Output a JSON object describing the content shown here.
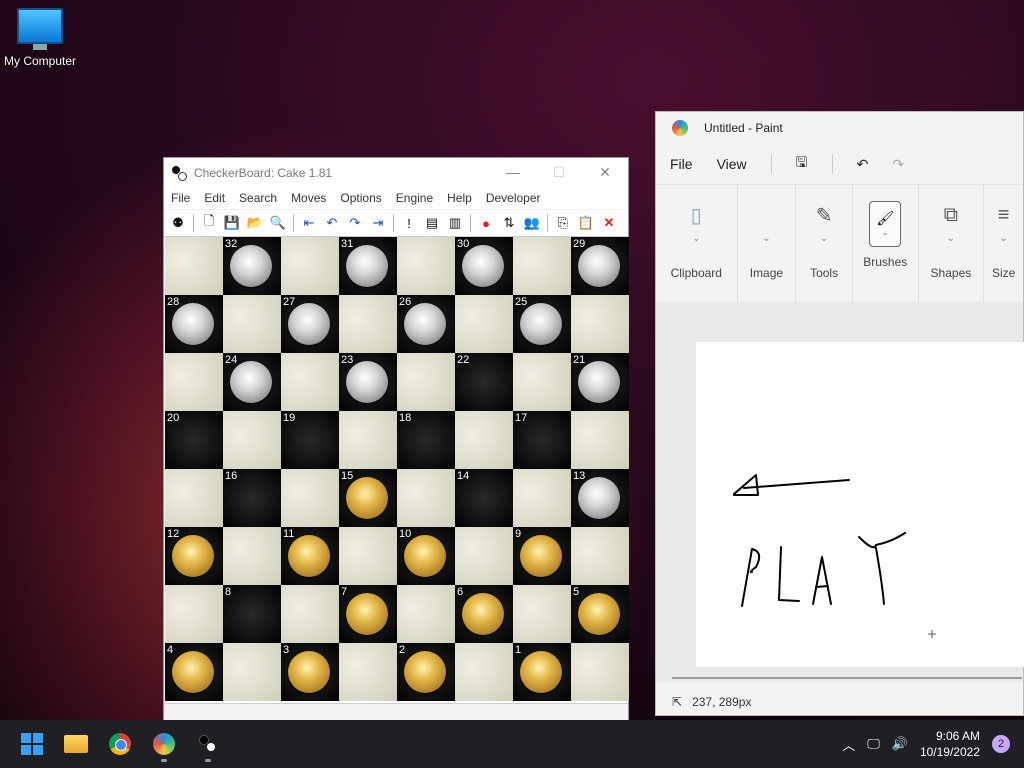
{
  "desktop": {
    "icon_label": "My Computer"
  },
  "checkers": {
    "title": "CheckerBoard: Cake 1.81",
    "menu": [
      "File",
      "Edit",
      "Search",
      "Moves",
      "Options",
      "Engine",
      "Help",
      "Developer"
    ],
    "board": [
      [
        null,
        {
          "n": "32",
          "p": "white"
        },
        null,
        {
          "n": "31",
          "p": "white"
        },
        null,
        {
          "n": "30",
          "p": "white"
        },
        null,
        {
          "n": "29",
          "p": "white"
        }
      ],
      [
        {
          "n": "28",
          "p": "white"
        },
        null,
        {
          "n": "27",
          "p": "white"
        },
        null,
        {
          "n": "26",
          "p": "white"
        },
        null,
        {
          "n": "25",
          "p": "white"
        },
        null
      ],
      [
        null,
        {
          "n": "24",
          "p": "white"
        },
        null,
        {
          "n": "23",
          "p": "white"
        },
        null,
        {
          "n": "22",
          "p": ""
        },
        null,
        {
          "n": "21",
          "p": "white"
        }
      ],
      [
        {
          "n": "20",
          "p": ""
        },
        null,
        {
          "n": "19",
          "p": ""
        },
        null,
        {
          "n": "18",
          "p": ""
        },
        null,
        {
          "n": "17",
          "p": ""
        },
        null
      ],
      [
        null,
        {
          "n": "16",
          "p": ""
        },
        null,
        {
          "n": "15",
          "p": "gold"
        },
        null,
        {
          "n": "14",
          "p": ""
        },
        null,
        {
          "n": "13",
          "p": "white"
        }
      ],
      [
        {
          "n": "12",
          "p": "gold"
        },
        null,
        {
          "n": "11",
          "p": "gold"
        },
        null,
        {
          "n": "10",
          "p": "gold"
        },
        null,
        {
          "n": "9",
          "p": "gold"
        },
        null
      ],
      [
        null,
        {
          "n": "8",
          "p": ""
        },
        null,
        {
          "n": "7",
          "p": "gold"
        },
        null,
        {
          "n": "6",
          "p": "gold"
        },
        null,
        {
          "n": "5",
          "p": "gold"
        }
      ],
      [
        {
          "n": "4",
          "p": "gold"
        },
        null,
        {
          "n": "3",
          "p": "gold"
        },
        null,
        {
          "n": "2",
          "p": "gold"
        },
        null,
        {
          "n": "1",
          "p": "gold"
        },
        null
      ]
    ]
  },
  "paint": {
    "title": "Untitled - Paint",
    "menu": {
      "file": "File",
      "view": "View"
    },
    "groups": [
      "Clipboard",
      "Image",
      "Tools",
      "Brushes",
      "Shapes",
      "Size"
    ],
    "status_coords": "237, 289px"
  },
  "taskbar": {
    "time": "9:06 AM",
    "date": "10/19/2022",
    "notifications": "2"
  },
  "colors": {
    "accent": "#3aa0ff",
    "taskbar": "#1f1f24"
  }
}
